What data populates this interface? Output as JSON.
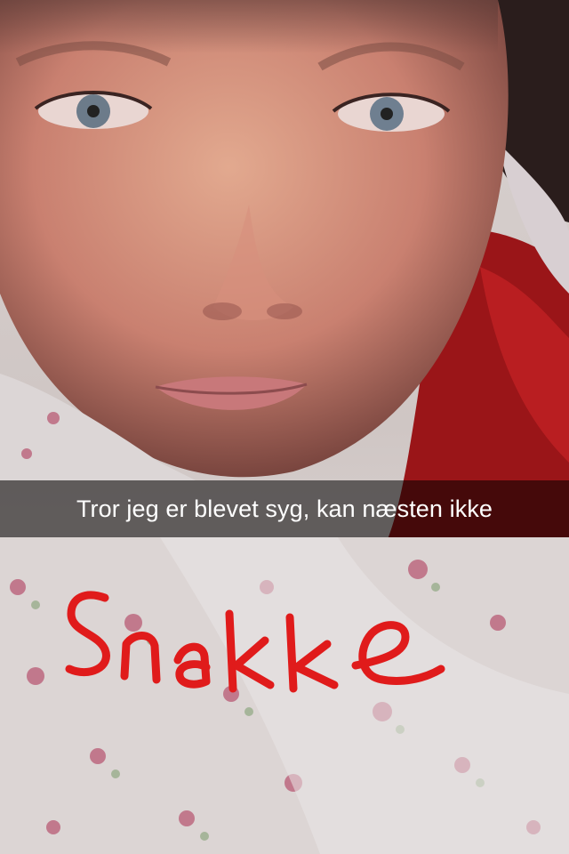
{
  "snap": {
    "caption": "Tror jeg er blevet syg, kan næsten ikke",
    "handwritten_text": "Snakke",
    "drawing_color": "#e01b1b",
    "caption_bar_color": "#000000"
  }
}
